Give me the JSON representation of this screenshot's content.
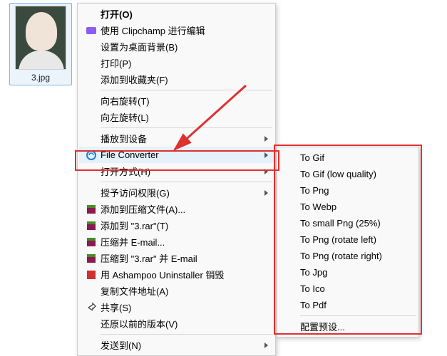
{
  "file": {
    "name": "3.jpg"
  },
  "menu": {
    "open": "打开(O)",
    "clipchamp": "使用 Clipchamp 进行编辑",
    "set_bg": "设置为桌面背景(B)",
    "print": "打印(P)",
    "add_fav": "添加到收藏夹(F)",
    "rotate_r": "向右旋转(T)",
    "rotate_l": "向左旋转(L)",
    "cast": "播放到设备",
    "file_converter": "File Converter",
    "open_with": "打开方式(H)",
    "grant_access": "授予访问权限(G)",
    "add_archive": "添加到压缩文件(A)...",
    "add_3rar": "添加到 \"3.rar\"(T)",
    "zip_email": "压缩并 E-mail...",
    "zip_3rar_email": "压缩到 \"3.rar\" 并 E-mail",
    "ashampoo": "用 Ashampoo Uninstaller 销毁",
    "copy_path": "复制文件地址(A)",
    "share": "共享(S)",
    "restore_prev": "还原以前的版本(V)",
    "send_to": "发送到(N)"
  },
  "submenu": {
    "to_gif": "To Gif",
    "to_gif_low": "To Gif (low quality)",
    "to_png": "To Png",
    "to_webp": "To Webp",
    "to_small_png": "To small Png (25%)",
    "to_png_rl": "To Png (rotate left)",
    "to_png_rr": "To Png (rotate right)",
    "to_jpg": "To Jpg",
    "to_ico": "To Ico",
    "to_pdf": "To Pdf",
    "configure": "配置预设..."
  }
}
